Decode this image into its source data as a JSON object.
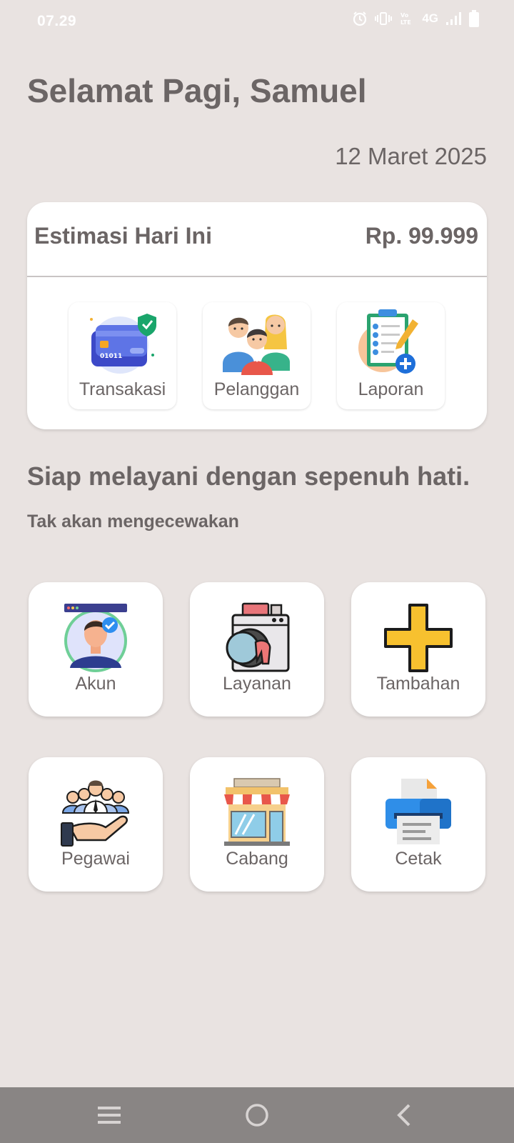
{
  "status_bar": {
    "time": "07.29",
    "network": "4G",
    "icons": [
      "alarm-icon",
      "vibrate-icon",
      "volte-icon",
      "signal-icon",
      "battery-icon"
    ]
  },
  "header": {
    "greeting": "Selamat Pagi, Samuel",
    "date": "12 Maret 2025"
  },
  "estimate": {
    "label": "Estimasi Hari Ini",
    "value": "Rp. 99.999"
  },
  "quick_actions": [
    {
      "label": "Transakasi",
      "icon": "credit-card-shield-icon"
    },
    {
      "label": "Pelanggan",
      "icon": "customers-group-icon"
    },
    {
      "label": "Laporan",
      "icon": "report-clipboard-icon"
    }
  ],
  "tagline": {
    "title": "Siap melayani dengan sepenuh hati.",
    "subtitle": "Tak akan mengecewakan"
  },
  "menu": [
    {
      "label": "Akun",
      "icon": "account-avatar-icon"
    },
    {
      "label": "Layanan",
      "icon": "washing-machine-icon"
    },
    {
      "label": "Tambahan",
      "icon": "plus-icon"
    },
    {
      "label": "Pegawai",
      "icon": "employees-hand-icon"
    },
    {
      "label": "Cabang",
      "icon": "store-icon"
    },
    {
      "label": "Cetak",
      "icon": "printer-icon"
    }
  ],
  "nav_bar": {
    "buttons": [
      "recent-apps",
      "home",
      "back"
    ]
  },
  "colors": {
    "background": "#e9e3e1",
    "card": "#ffffff",
    "text": "#6b6565",
    "nav_bar": "#898584"
  }
}
